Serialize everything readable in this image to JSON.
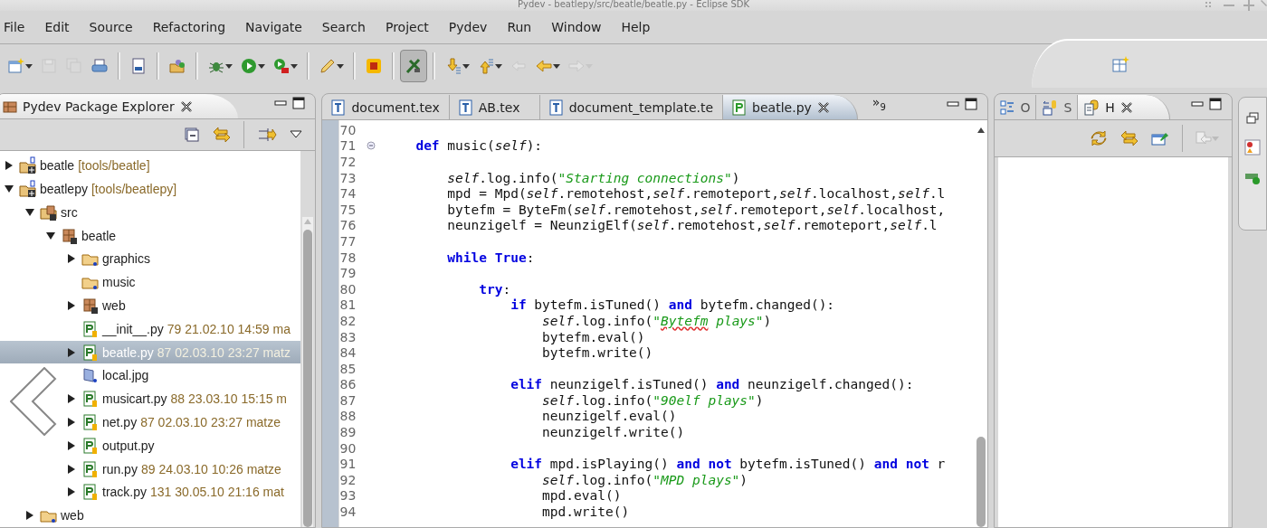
{
  "window": {
    "title": "Pydev - beatlepy/src/beatle/beatle.py - Eclipse SDK"
  },
  "menu": [
    "File",
    "Edit",
    "Source",
    "Refactoring",
    "Navigate",
    "Search",
    "Project",
    "Pydev",
    "Run",
    "Window",
    "Help"
  ],
  "toolbar": [
    {
      "kind": "new",
      "disabled": false,
      "dropdown": true
    },
    {
      "kind": "save",
      "disabled": true,
      "dropdown": false
    },
    {
      "kind": "save-all",
      "disabled": true,
      "dropdown": false
    },
    {
      "kind": "print",
      "disabled": false,
      "dropdown": false
    },
    {
      "kind": "separator"
    },
    {
      "kind": "binary",
      "disabled": false,
      "dropdown": false
    },
    {
      "kind": "separator"
    },
    {
      "kind": "open-project",
      "disabled": false,
      "dropdown": false
    },
    {
      "kind": "separator"
    },
    {
      "kind": "debug",
      "disabled": false,
      "dropdown": true
    },
    {
      "kind": "run",
      "disabled": false,
      "dropdown": true
    },
    {
      "kind": "run-tool",
      "disabled": false,
      "dropdown": true
    },
    {
      "kind": "separator"
    },
    {
      "kind": "marker",
      "disabled": false,
      "dropdown": true
    },
    {
      "kind": "separator"
    },
    {
      "kind": "stop",
      "disabled": false,
      "dropdown": false
    },
    {
      "kind": "separator"
    },
    {
      "kind": "toggle",
      "disabled": false,
      "dropdown": false,
      "selected": true
    },
    {
      "kind": "separator"
    },
    {
      "kind": "next",
      "disabled": false,
      "dropdown": true
    },
    {
      "kind": "previous",
      "disabled": false,
      "dropdown": true
    },
    {
      "kind": "last-edit",
      "disabled": true,
      "dropdown": false
    },
    {
      "kind": "back",
      "disabled": false,
      "dropdown": true
    },
    {
      "kind": "forward",
      "disabled": true,
      "dropdown": true
    }
  ],
  "explorer": {
    "title": "Pydev Package Explorer",
    "tree": [
      {
        "label": "beatle",
        "detail": "[tools/beatle]",
        "kind": "project",
        "expanded": false,
        "selected": false
      },
      {
        "label": "beatlepy",
        "detail": "[tools/beatlepy]",
        "kind": "project",
        "expanded": true,
        "selected": false,
        "children": [
          {
            "label": "src",
            "kind": "source-folder",
            "expanded": true,
            "selected": false,
            "children": [
              {
                "label": "beatle",
                "kind": "package",
                "expanded": true,
                "selected": false,
                "children": [
                  {
                    "label": "graphics",
                    "kind": "folder",
                    "expanded": false,
                    "selected": false
                  },
                  {
                    "label": "music",
                    "kind": "folder",
                    "selected": false
                  },
                  {
                    "label": "web",
                    "kind": "package",
                    "expanded": false,
                    "selected": false
                  },
                  {
                    "label": "__init__.py",
                    "detail": "79  21.02.10 14:59  ma",
                    "kind": "python-file",
                    "selected": false
                  },
                  {
                    "label": "beatle.py",
                    "detail": "87  02.03.10 23:27  matz",
                    "kind": "python-file",
                    "expanded": false,
                    "selected": true
                  },
                  {
                    "label": "local.jpg",
                    "kind": "image-file",
                    "selected": false
                  },
                  {
                    "label": "musicart.py",
                    "detail": "88  23.03.10 15:15  m",
                    "kind": "python-file",
                    "expanded": false,
                    "selected": false
                  },
                  {
                    "label": "net.py",
                    "detail": "87  02.03.10 23:27  matze",
                    "kind": "python-file",
                    "expanded": false,
                    "selected": false
                  },
                  {
                    "label": "output.py",
                    "kind": "python-file",
                    "expanded": false,
                    "selected": false
                  },
                  {
                    "label": "run.py",
                    "detail": "89  24.03.10 10:26  matze",
                    "kind": "python-file",
                    "expanded": false,
                    "selected": false
                  },
                  {
                    "label": "track.py",
                    "detail": "131  30.05.10 21:16  mat",
                    "kind": "python-file",
                    "expanded": false,
                    "selected": false
                  }
                ]
              }
            ]
          },
          {
            "label": "web",
            "kind": "folder",
            "expanded": false,
            "selected": false
          }
        ]
      }
    ]
  },
  "editor": {
    "tabs": [
      {
        "label": "document.tex",
        "kind": "tex",
        "selected": false
      },
      {
        "label": "AB.tex",
        "kind": "tex",
        "selected": false
      },
      {
        "label": "document_template.te",
        "kind": "tex",
        "selected": false
      },
      {
        "label": "beatle.py",
        "kind": "python",
        "selected": true
      }
    ],
    "overflow": {
      "glyph": "»",
      "count": "9"
    },
    "lines": [
      {
        "number": "70",
        "foldable": false
      },
      {
        "number": "71",
        "foldable": true,
        "tokens": [
          {
            "t": "    def",
            "kind": "keyword"
          },
          {
            "t": " music(",
            "kind": "plain"
          },
          {
            "t": "self",
            "kind": "self"
          },
          {
            "t": "):",
            "kind": "plain"
          }
        ]
      },
      {
        "number": "72",
        "foldable": false
      },
      {
        "number": "73",
        "foldable": false,
        "tokens": [
          {
            "t": "        self",
            "kind": "self"
          },
          {
            "t": ".log.info(",
            "kind": "plain"
          },
          {
            "t": "\"Starting connections\"",
            "kind": "string"
          },
          {
            "t": ")",
            "kind": "plain"
          }
        ]
      },
      {
        "number": "74",
        "foldable": false,
        "tokens": [
          {
            "t": "        mpd = Mpd(",
            "kind": "plain"
          },
          {
            "t": "self",
            "kind": "self"
          },
          {
            "t": ".remotehost,",
            "kind": "plain"
          },
          {
            "t": "self",
            "kind": "self"
          },
          {
            "t": ".remoteport,",
            "kind": "plain"
          },
          {
            "t": "self",
            "kind": "self"
          },
          {
            "t": ".localhost,",
            "kind": "plain"
          },
          {
            "t": "self",
            "kind": "self"
          },
          {
            "t": ".l",
            "kind": "plain"
          }
        ]
      },
      {
        "number": "75",
        "foldable": false,
        "tokens": [
          {
            "t": "        bytefm = ByteFm(",
            "kind": "plain"
          },
          {
            "t": "self",
            "kind": "self"
          },
          {
            "t": ".remotehost,",
            "kind": "plain"
          },
          {
            "t": "self",
            "kind": "self"
          },
          {
            "t": ".remoteport,",
            "kind": "plain"
          },
          {
            "t": "self",
            "kind": "self"
          },
          {
            "t": ".localhost,",
            "kind": "plain"
          }
        ]
      },
      {
        "number": "76",
        "foldable": false,
        "tokens": [
          {
            "t": "        neunzigelf = NeunzigElf(",
            "kind": "plain"
          },
          {
            "t": "self",
            "kind": "self"
          },
          {
            "t": ".remotehost,",
            "kind": "plain"
          },
          {
            "t": "self",
            "kind": "self"
          },
          {
            "t": ".remoteport,",
            "kind": "plain"
          },
          {
            "t": "self",
            "kind": "self"
          },
          {
            "t": ".l",
            "kind": "plain"
          }
        ]
      },
      {
        "number": "77",
        "foldable": false
      },
      {
        "number": "78",
        "foldable": false,
        "tokens": [
          {
            "t": "        while True",
            "kind": "keyword"
          },
          {
            "t": ":",
            "kind": "plain"
          }
        ]
      },
      {
        "number": "79",
        "foldable": false
      },
      {
        "number": "80",
        "foldable": false,
        "tokens": [
          {
            "t": "            try",
            "kind": "keyword"
          },
          {
            "t": ":",
            "kind": "plain"
          }
        ]
      },
      {
        "number": "81",
        "foldable": false,
        "tokens": [
          {
            "t": "                if",
            "kind": "keyword"
          },
          {
            "t": " bytefm.isTuned() ",
            "kind": "plain"
          },
          {
            "t": "and",
            "kind": "keyword"
          },
          {
            "t": " bytefm.changed():",
            "kind": "plain"
          }
        ]
      },
      {
        "number": "82",
        "foldable": false,
        "tokens": [
          {
            "t": "                    self",
            "kind": "self"
          },
          {
            "t": ".log.info(",
            "kind": "plain"
          },
          {
            "t": "\"",
            "kind": "string"
          },
          {
            "t": "Bytefm",
            "kind": "misspelled"
          },
          {
            "t": " plays\"",
            "kind": "string"
          },
          {
            "t": ")",
            "kind": "plain"
          }
        ]
      },
      {
        "number": "83",
        "foldable": false,
        "tokens": [
          {
            "t": "                    bytefm.eval()",
            "kind": "plain"
          }
        ]
      },
      {
        "number": "84",
        "foldable": false,
        "tokens": [
          {
            "t": "                    bytefm.write()",
            "kind": "plain"
          }
        ]
      },
      {
        "number": "85",
        "foldable": false
      },
      {
        "number": "86",
        "foldable": false,
        "tokens": [
          {
            "t": "                elif",
            "kind": "keyword"
          },
          {
            "t": " neunzigelf.isTuned() ",
            "kind": "plain"
          },
          {
            "t": "and",
            "kind": "keyword"
          },
          {
            "t": " neunzigelf.changed():",
            "kind": "plain"
          }
        ]
      },
      {
        "number": "87",
        "foldable": false,
        "tokens": [
          {
            "t": "                    self",
            "kind": "self"
          },
          {
            "t": ".log.info(",
            "kind": "plain"
          },
          {
            "t": "\"90elf plays\"",
            "kind": "string"
          },
          {
            "t": ")",
            "kind": "plain"
          }
        ]
      },
      {
        "number": "88",
        "foldable": false,
        "tokens": [
          {
            "t": "                    neunzigelf.eval()",
            "kind": "plain"
          }
        ]
      },
      {
        "number": "89",
        "foldable": false,
        "tokens": [
          {
            "t": "                    neunzigelf.write()",
            "kind": "plain"
          }
        ]
      },
      {
        "number": "90",
        "foldable": false
      },
      {
        "number": "91",
        "foldable": false,
        "tokens": [
          {
            "t": "                elif",
            "kind": "keyword"
          },
          {
            "t": " mpd.isPlaying() ",
            "kind": "plain"
          },
          {
            "t": "and not",
            "kind": "keyword"
          },
          {
            "t": " bytefm.isTuned() ",
            "kind": "plain"
          },
          {
            "t": "and not",
            "kind": "keyword"
          },
          {
            "t": " r",
            "kind": "plain"
          }
        ]
      },
      {
        "number": "92",
        "foldable": false,
        "tokens": [
          {
            "t": "                    self",
            "kind": "self"
          },
          {
            "t": ".log.info(",
            "kind": "plain"
          },
          {
            "t": "\"MPD plays\"",
            "kind": "string"
          },
          {
            "t": ")",
            "kind": "plain"
          }
        ]
      },
      {
        "number": "93",
        "foldable": false,
        "tokens": [
          {
            "t": "                    mpd.eval()",
            "kind": "plain"
          }
        ]
      },
      {
        "number": "94",
        "foldable": false,
        "tokens": [
          {
            "t": "                    mpd.write()",
            "kind": "plain"
          }
        ]
      }
    ]
  },
  "side_panel": {
    "tabs": [
      {
        "label": "O",
        "kind": "outline",
        "selected": false
      },
      {
        "label": "S",
        "kind": "structure",
        "selected": false
      },
      {
        "label": "H",
        "kind": "hierarchy",
        "selected": true
      }
    ]
  }
}
